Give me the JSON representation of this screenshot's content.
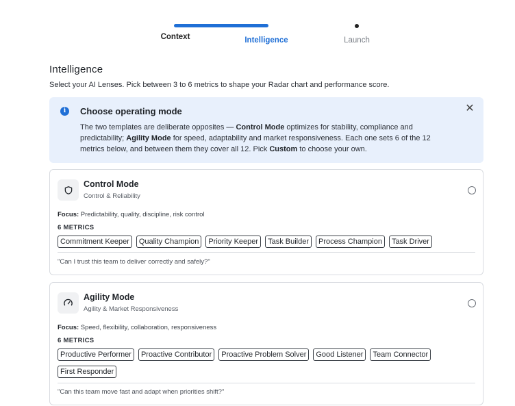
{
  "stepper": {
    "steps": [
      {
        "label": "Context",
        "state": "completed"
      },
      {
        "label": "Intelligence",
        "state": "active"
      },
      {
        "label": "Launch",
        "state": "upcoming"
      }
    ]
  },
  "page": {
    "title": "Intelligence",
    "subtitle": "Select your AI Lenses. Pick between 3 to 6 metrics to shape your Radar chart and performance score."
  },
  "banner": {
    "title": "Choose operating mode",
    "text_1": "The two templates are deliberate opposites — ",
    "bold_control": "Control Mode",
    "text_2": " optimizes for stability, compliance and predictability; ",
    "bold_agility": "Agility Mode",
    "text_3": " for speed, adaptability and market responsiveness. Each one sets 6 of the 12 metrics below, and between them they cover all 12. Pick ",
    "bold_custom": "Custom",
    "text_4": " to choose your own.",
    "close_icon": "close-icon",
    "info_icon": "info-icon",
    "accent_color": "#1f6fd6",
    "background_color": "#e8f0fc"
  },
  "modes": [
    {
      "title": "Control Mode",
      "subtitle": "Control & Reliability",
      "icon": "shield-icon",
      "focus_label": "Focus:",
      "focus_text": "Predictability, quality, discipline, risk control",
      "metrics_label": "6 METRICS",
      "metrics": [
        "Commitment Keeper",
        "Quality Champion",
        "Priority Keeper",
        "Task Builder",
        "Process Champion",
        "Task Driver"
      ],
      "quote": "\"Can I trust this team to deliver correctly and safely?\"",
      "selected": false
    },
    {
      "title": "Agility Mode",
      "subtitle": "Agility & Market Responsiveness",
      "icon": "gauge-icon",
      "focus_label": "Focus:",
      "focus_text": "Speed, flexibility, collaboration, responsiveness",
      "metrics_label": "6 METRICS",
      "metrics": [
        "Productive Performer",
        "Proactive Contributor",
        "Proactive Problem Solver",
        "Good Listener",
        "Team Connector",
        "First Responder"
      ],
      "quote": "\"Can this team move fast and adapt when priorities shift?\"",
      "selected": false
    }
  ]
}
